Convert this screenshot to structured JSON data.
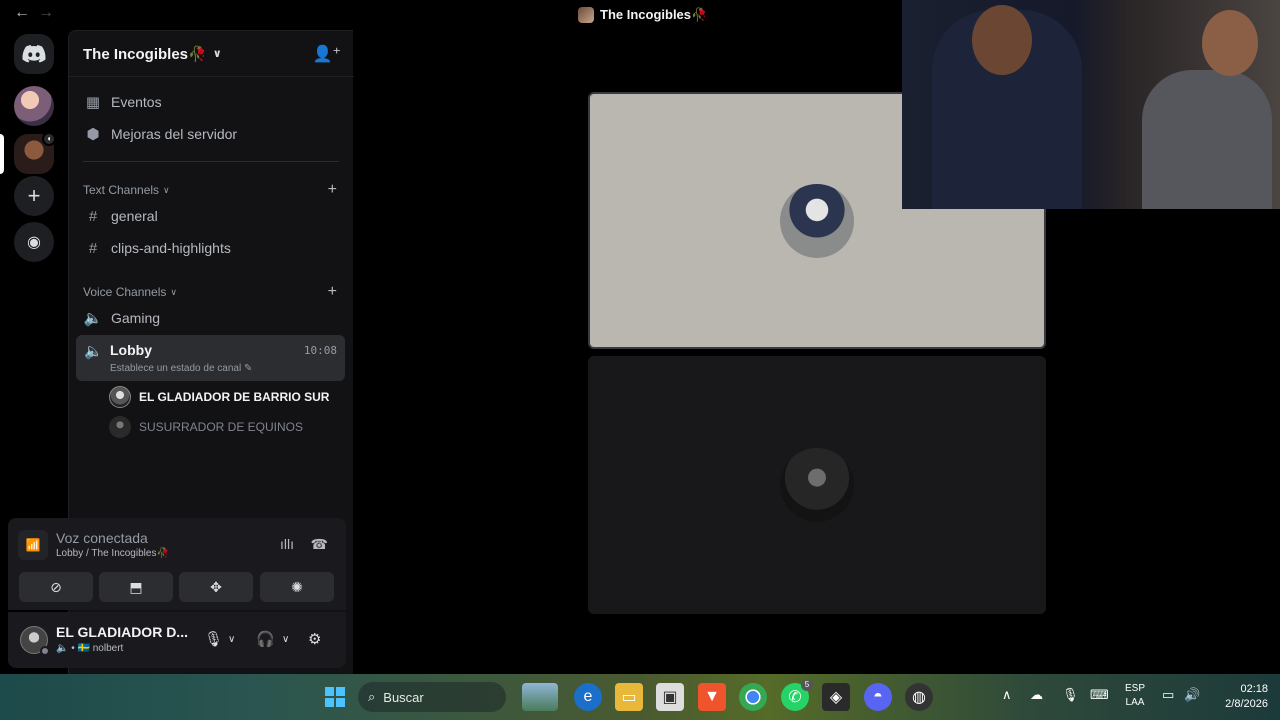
{
  "titlebar": {
    "back_icon": "arrow-left-icon",
    "forward_icon": "arrow-right-icon",
    "title": "The Incogibles🥀"
  },
  "rail": {
    "home_icon": "discord-icon",
    "add_server_icon": "plus-icon",
    "explore_icon": "compass-icon"
  },
  "server": {
    "name": "The Incogibles🥀",
    "menu_items": [
      {
        "label": "Eventos",
        "icon": "calendar-icon"
      },
      {
        "label": "Mejoras del servidor",
        "icon": "boost-icon"
      }
    ]
  },
  "text_channels": {
    "category": "Text Channels",
    "channels": [
      "general",
      "clips-and-highlights"
    ]
  },
  "voice_channels": {
    "category": "Voice Channels",
    "channels": [
      {
        "name": "Gaming"
      },
      {
        "name": "Lobby",
        "time": "10:08",
        "status": "Establece un estado de canal"
      }
    ],
    "users": [
      "EL GLADIADOR DE BARRIO SUR",
      "SUSURRADOR DE EQUINOS"
    ]
  },
  "voice_panel": {
    "title": "Voz conectada",
    "subtitle": "Lobby / The Incogibles🥀"
  },
  "user_panel": {
    "name": "EL GLADIADOR D...",
    "sub": "🔈 • 🇸🇪 nolbert"
  },
  "taskbar": {
    "search_label": "Buscar",
    "whatsapp_badge": "5",
    "lang_line1": "ESP",
    "lang_line2": "LAA",
    "time": "02:18",
    "date": "2/8/2026"
  },
  "colors": {
    "background": "#000000",
    "sidebar": "#121214",
    "selected_channel": "#2b2d31",
    "tile_light": "#bab7b1",
    "tile_dark": "#18181b"
  }
}
